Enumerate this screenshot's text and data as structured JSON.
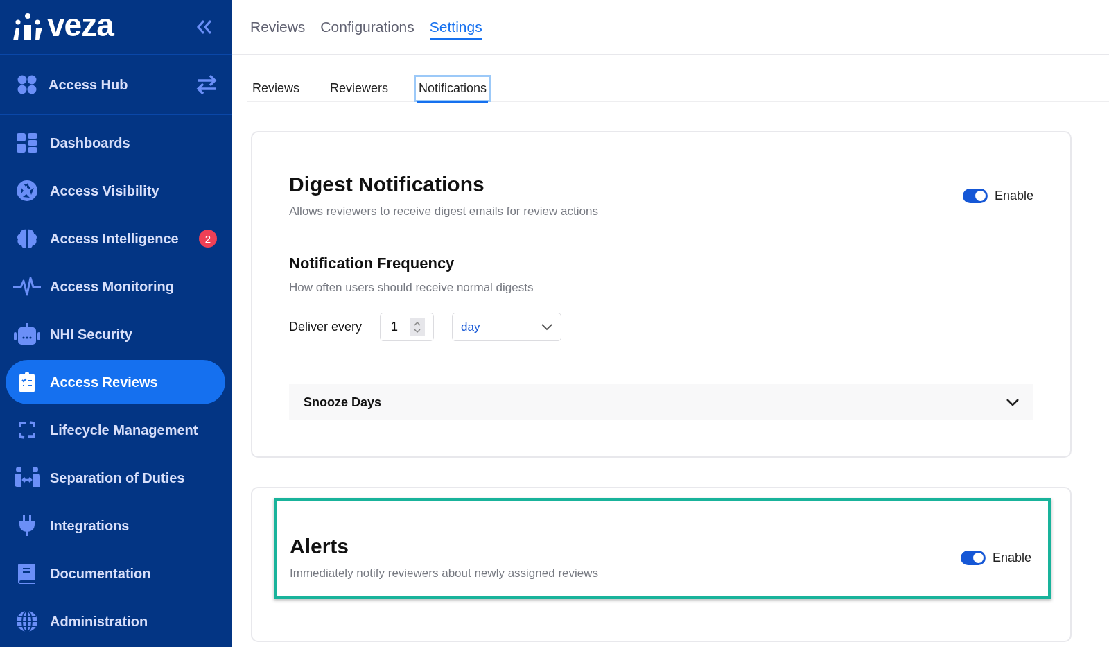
{
  "logo": {
    "text": "veza"
  },
  "sidebar": {
    "hub": {
      "label": "Access Hub"
    },
    "items": [
      {
        "label": "Dashboards",
        "selected": false
      },
      {
        "label": "Access Visibility",
        "selected": false
      },
      {
        "label": "Access Intelligence",
        "selected": false,
        "badge": "2"
      },
      {
        "label": "Access Monitoring",
        "selected": false
      },
      {
        "label": "NHI Security",
        "selected": false
      },
      {
        "label": "Access Reviews",
        "selected": true
      },
      {
        "label": "Lifecycle Management",
        "selected": false
      },
      {
        "label": "Separation of Duties",
        "selected": false
      },
      {
        "label": "Integrations",
        "selected": false
      },
      {
        "label": "Documentation",
        "selected": false
      },
      {
        "label": "Administration",
        "selected": false
      }
    ]
  },
  "top_tabs": [
    {
      "label": "Reviews",
      "selected": false
    },
    {
      "label": "Configurations",
      "selected": false
    },
    {
      "label": "Settings",
      "selected": true
    }
  ],
  "sub_tabs": [
    {
      "label": "Reviews",
      "selected": false,
      "focused": false
    },
    {
      "label": "Reviewers",
      "selected": false,
      "focused": false
    },
    {
      "label": "Notifications",
      "selected": true,
      "focused": true
    }
  ],
  "digest": {
    "title": "Digest Notifications",
    "description": "Allows reviewers to receive digest emails for review actions",
    "enabled": true,
    "toggle_label": "Enable",
    "frequency": {
      "title": "Notification Frequency",
      "description": "How often users should receive normal digests",
      "deliver_label": "Deliver every",
      "count": "1",
      "unit": "day"
    },
    "snooze": {
      "label": "Snooze Days",
      "expanded": false
    }
  },
  "alerts": {
    "title": "Alerts",
    "description": "Immediately notify reviewers about newly assigned reviews",
    "enabled": true,
    "toggle_label": "Enable",
    "highlighted": true
  }
}
